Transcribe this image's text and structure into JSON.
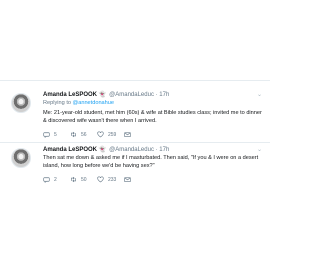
{
  "tweets": [
    {
      "name": "Amanda LeSPOOK 👻",
      "handle": "@AmandaLeduc · 17h",
      "reply_prefix": "Replying to ",
      "reply_to": "@annetdonahue",
      "text": "Me: 21-year-old student, met him (60s) & wife at Bible studies class; invited me to dinner & discovered wife wasn't there when I arrived.",
      "replies": "5",
      "retweets": "56",
      "likes": "259"
    },
    {
      "name": "Amanda LeSPOOK 👻",
      "handle": "@AmandaLeduc · 17h",
      "text": "Then sat me down & asked me if I masturbated. Then said, \"If you & I were on a desert island, how long before we'd be having sex?\"",
      "replies": "2",
      "retweets": "50",
      "likes": "233"
    }
  ],
  "icons": {
    "reply": "reply-icon",
    "retweet": "retweet-icon",
    "like": "heart-icon",
    "dm": "envelope-icon",
    "menu": "chevron-down-icon"
  },
  "colors": {
    "link": "#1da1f2",
    "secondary_text": "#657786",
    "divider": "#e6ecf0"
  }
}
